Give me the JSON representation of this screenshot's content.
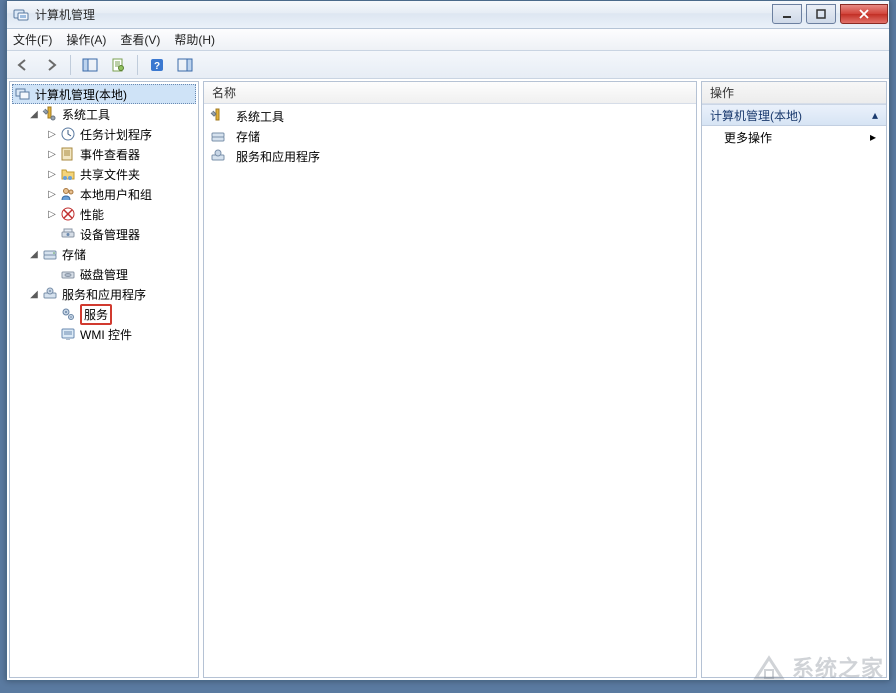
{
  "window": {
    "title": "计算机管理"
  },
  "menu": {
    "file": "文件(F)",
    "action": "操作(A)",
    "view": "查看(V)",
    "help": "帮助(H)"
  },
  "tree": {
    "root": "计算机管理(本地)",
    "system_tools": "系统工具",
    "task_scheduler": "任务计划程序",
    "event_viewer": "事件查看器",
    "shared_folders": "共享文件夹",
    "local_users": "本地用户和组",
    "performance": "性能",
    "device_manager": "设备管理器",
    "storage": "存储",
    "disk_management": "磁盘管理",
    "services_apps": "服务和应用程序",
    "services": "服务",
    "wmi_control": "WMI 控件"
  },
  "center": {
    "header_name": "名称",
    "items": {
      "system_tools": "系统工具",
      "storage": "存储",
      "services_apps": "服务和应用程序"
    }
  },
  "right": {
    "header": "操作",
    "section_title": "计算机管理(本地)",
    "more_actions": "更多操作"
  },
  "watermark": "系统之家"
}
